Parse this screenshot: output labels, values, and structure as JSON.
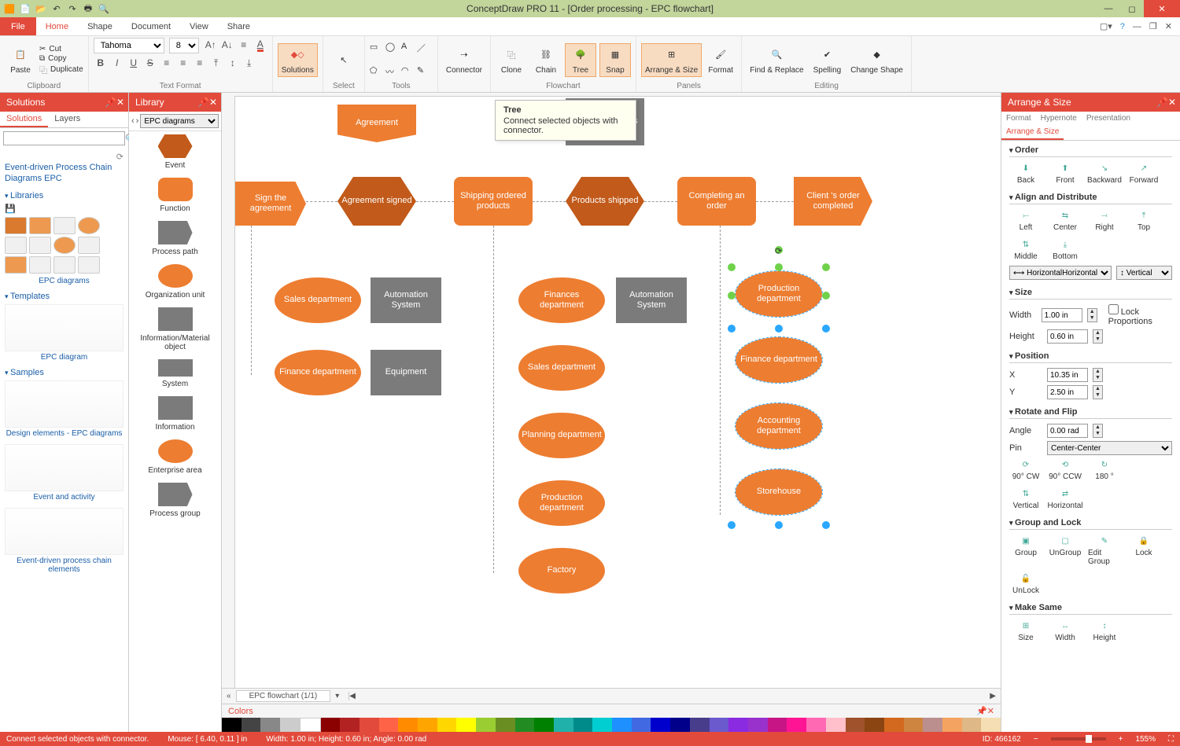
{
  "title": "ConceptDraw PRO 11 - [Order processing - EPC flowchart]",
  "tabs": {
    "file": "File",
    "home": "Home",
    "shape": "Shape",
    "document": "Document",
    "view": "View",
    "share": "Share"
  },
  "clipboard": {
    "paste": "Paste",
    "cut": "Cut",
    "copy": "Copy",
    "duplicate": "Duplicate",
    "group": "Clipboard"
  },
  "textformat": {
    "font": "Tahoma",
    "size": "8",
    "group": "Text Format"
  },
  "ribbon": {
    "solutions": "Solutions",
    "select": "Select",
    "tools": "Tools",
    "connector": "Connector",
    "clone": "Clone",
    "chain": "Chain",
    "tree": "Tree",
    "snap": "Snap",
    "flowchart": "Flowchart",
    "arrange": "Arrange & Size",
    "format": "Format",
    "panels": "Panels",
    "find": "Find & Replace",
    "spelling": "Spelling",
    "changeshape": "Change Shape",
    "editing": "Editing"
  },
  "tooltip": {
    "title": "Tree",
    "body": "Connect selected objects with connector."
  },
  "solutions_panel": {
    "title": "Solutions",
    "tabs": {
      "solutions": "Solutions",
      "layers": "Layers"
    },
    "tree_root": "Event-driven Process Chain Diagrams EPC",
    "sections": {
      "libraries": "Libraries",
      "templates": "Templates",
      "samples": "Samples"
    },
    "lib_caption": "EPC diagrams",
    "templ_caption": "EPC diagram",
    "samples": [
      "Design elements - EPC diagrams",
      "Event and activity",
      "Event-driven process chain elements"
    ]
  },
  "library_panel": {
    "title": "Library",
    "selector": "EPC diagrams",
    "items": [
      {
        "name": "Event"
      },
      {
        "name": "Function"
      },
      {
        "name": "Process path"
      },
      {
        "name": "Organization unit"
      },
      {
        "name": "Information/Material object"
      },
      {
        "name": "System"
      },
      {
        "name": "Information"
      },
      {
        "name": "Enterprise area"
      },
      {
        "name": "Process group"
      }
    ]
  },
  "canvas": {
    "banner_agreement": "Agreement",
    "rect_ordered": "ordered products",
    "sign": "Sign the agreement",
    "agreement_signed": "Agreement signed",
    "shipping": "Shipping ordered products",
    "products_shipped": "Products shipped",
    "completing": "Completing an order",
    "client_order": "Client 's order completed",
    "sales1": "Sales department",
    "autom1": "Automation System",
    "finance1": "Finance department",
    "equipment": "Equipment",
    "finances2": "Finances department",
    "autom2": "Automation System",
    "sales2": "Sales department",
    "planning": "Planning department",
    "production2": "Production department",
    "factory": "Factory",
    "sel_prod": "Production department",
    "sel_fin": "Finance department",
    "sel_acct": "Accounting department",
    "sel_store": "Storehouse",
    "sheet": "EPC flowchart (1/1)",
    "colors_label": "Colors"
  },
  "right": {
    "title": "Arrange & Size",
    "tabs": [
      "Format",
      "Hypernote",
      "Presentation",
      "Arrange & Size"
    ],
    "order": {
      "h": "Order",
      "back": "Back",
      "front": "Front",
      "backward": "Backward",
      "forward": "Forward"
    },
    "align": {
      "h": "Align and Distribute",
      "left": "Left",
      "center": "Center",
      "right": "Right",
      "top": "Top",
      "middle": "Middle",
      "bottom": "Bottom",
      "horiz": "Horizontal",
      "vert": "Vertical"
    },
    "size": {
      "h": "Size",
      "width_l": "Width",
      "width_v": "1.00 in",
      "height_l": "Height",
      "height_v": "0.60 in",
      "lock": "Lock Proportions"
    },
    "position": {
      "h": "Position",
      "x_l": "X",
      "x_v": "10.35 in",
      "y_l": "Y",
      "y_v": "2.50 in"
    },
    "rotate": {
      "h": "Rotate and Flip",
      "angle_l": "Angle",
      "angle_v": "0.00 rad",
      "pin_l": "Pin",
      "pin_v": "Center-Center",
      "cw": "90° CW",
      "ccw": "90° CCW",
      "r180": "180 °",
      "flip": "Flip",
      "vert": "Vertical",
      "horiz": "Horizontal"
    },
    "group": {
      "h": "Group and Lock",
      "group": "Group",
      "ungroup": "UnGroup",
      "editg": "Edit Group",
      "lock": "Lock",
      "unlock": "UnLock"
    },
    "same": {
      "h": "Make Same",
      "size": "Size",
      "width": "Width",
      "height": "Height"
    }
  },
  "status": {
    "hint": "Connect selected objects with connector.",
    "mouse": "Mouse: [ 6.40, 0.11 ] in",
    "dims": "Width: 1.00 in;  Height: 0.60 in;  Angle: 0.00 rad",
    "id": "ID: 466162",
    "zoom": "155%"
  }
}
